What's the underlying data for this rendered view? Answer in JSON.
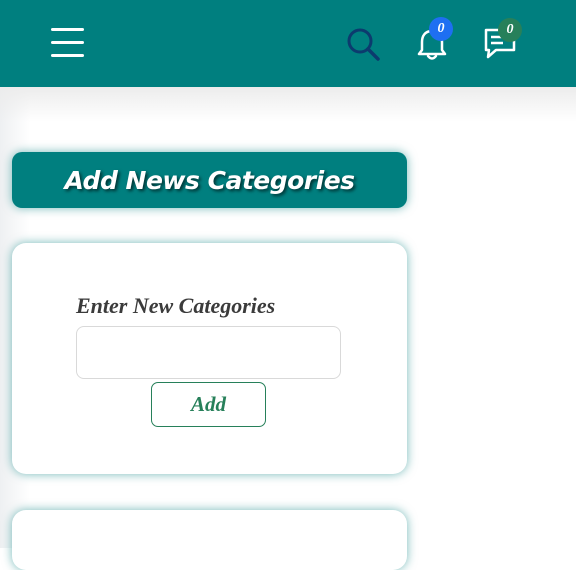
{
  "header": {
    "menu_icon": "hamburger-menu-icon",
    "search_icon": "search-icon",
    "notifications": {
      "icon": "bell-icon",
      "count": "0",
      "badge_color": "#1e6ff2"
    },
    "messages": {
      "icon": "chat-icon",
      "count": "0",
      "badge_color": "#27805a"
    },
    "bar_color": "#007f7f"
  },
  "page": {
    "title": "Add News Categories"
  },
  "form": {
    "label": "Enter New Categories",
    "input_value": "",
    "input_placeholder": "",
    "submit_label": "Add",
    "accent_color": "#27805a"
  }
}
